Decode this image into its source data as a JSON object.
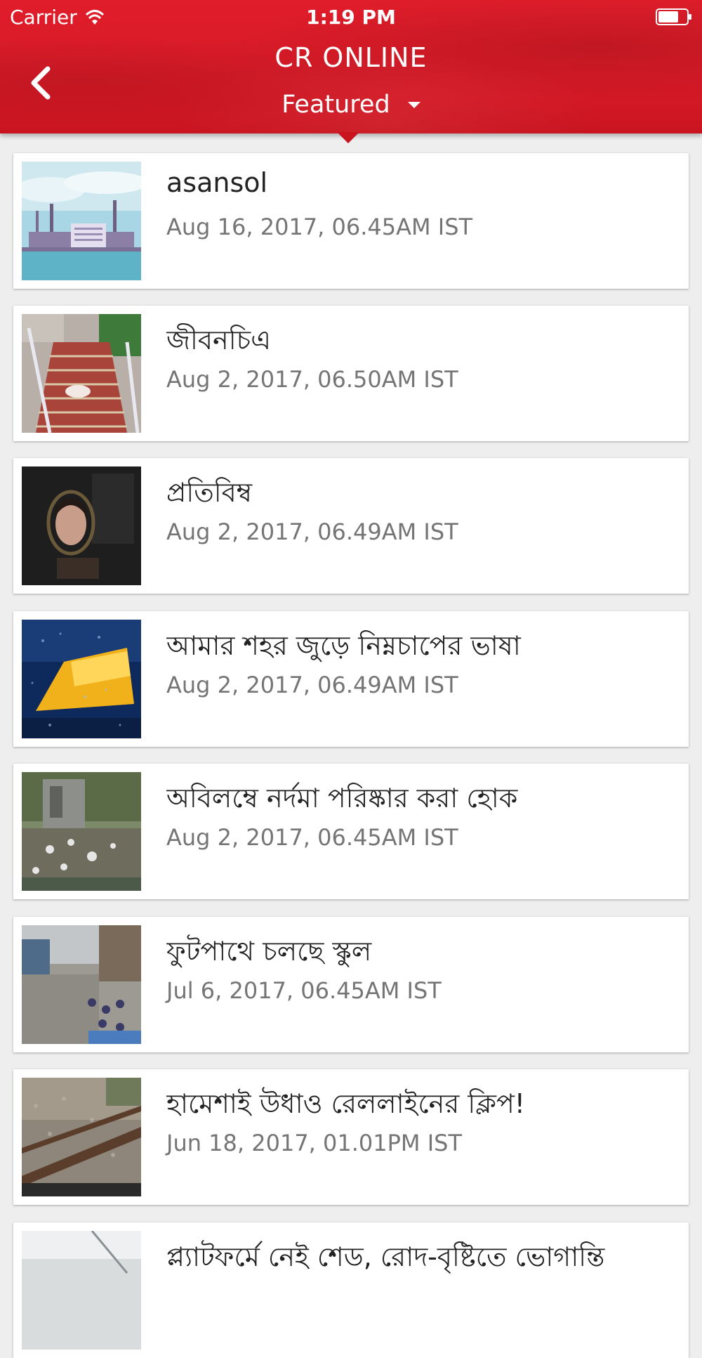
{
  "status_bar": {
    "carrier": "Carrier",
    "time": "1:19 PM"
  },
  "header": {
    "title": "CR ONLINE",
    "feed_selector": "Featured",
    "background_color": "#d81a27"
  },
  "articles": [
    {
      "title": "asansol",
      "date": "Aug 16, 2017, 06.45AM IST"
    },
    {
      "title": "জীবনচিএ",
      "date": "Aug 2, 2017, 06.50AM IST"
    },
    {
      "title": "প্রতিবিম্ব",
      "date": "Aug 2, 2017, 06.49AM IST"
    },
    {
      "title": "আমার শহর জুড়ে নিম্নচাপের ভাষা",
      "date": "Aug 2, 2017, 06.49AM IST"
    },
    {
      "title": "অবিলম্বে নর্দমা পরিষ্কার করা হোক",
      "date": "Aug 2, 2017, 06.45AM IST"
    },
    {
      "title": "ফুটপাথে চলছে স্কুল",
      "date": "Jul 6, 2017, 06.45AM IST"
    },
    {
      "title": "হামেশাই উধাও রেললাইনের ক্লিপ!",
      "date": "Jun 18, 2017, 01.01PM IST"
    },
    {
      "title": "প্ল্যাটফর্মে নেই শেড, রোদ-বৃষ্টিতে ভোগান্তি",
      "date": ""
    }
  ]
}
